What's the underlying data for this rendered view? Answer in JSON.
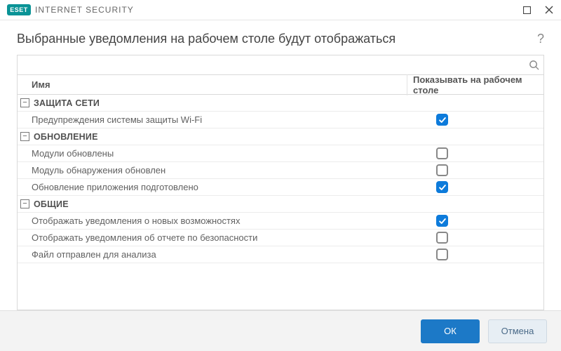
{
  "app": {
    "brand": "ESET",
    "product": "INTERNET SECURITY"
  },
  "header": {
    "title": "Выбранные уведомления на рабочем столе будут отображаться"
  },
  "search": {
    "value": ""
  },
  "columns": {
    "name": "Имя",
    "show": "Показывать на рабочем столе"
  },
  "groups": [
    {
      "id": "network",
      "label": "ЗАЩИТА СЕТИ",
      "items": [
        {
          "label": "Предупреждения системы защиты Wi-Fi",
          "checked": true
        }
      ]
    },
    {
      "id": "update",
      "label": "ОБНОВЛЕНИЕ",
      "items": [
        {
          "label": "Модули обновлены",
          "checked": false
        },
        {
          "label": "Модуль обнаружения обновлен",
          "checked": false
        },
        {
          "label": "Обновление приложения подготовлено",
          "checked": true
        }
      ]
    },
    {
      "id": "general",
      "label": "ОБЩИЕ",
      "items": [
        {
          "label": "Отображать уведомления о новых возможностях",
          "checked": true
        },
        {
          "label": "Отображать уведомления об отчете по безопасности",
          "checked": false
        },
        {
          "label": "Файл отправлен для анализа",
          "checked": false
        }
      ]
    }
  ],
  "buttons": {
    "ok": "ОК",
    "cancel": "Отмена"
  }
}
